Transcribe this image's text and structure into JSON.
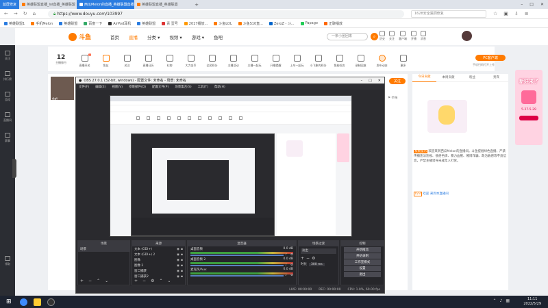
{
  "browser": {
    "tabs": [
      {
        "label": "英雄联盟直播_lol直播_英雄联盟",
        "active": false
      },
      {
        "label": "西瓜Melon的直播_英雄联盟直播",
        "active": true
      },
      {
        "label": "英雄联盟直播_英雄联盟",
        "active": false
      }
    ],
    "url": "https://www.douyu.com/103997",
    "search_hint": "1628安全漏洞修复",
    "sidebar_badge": "蓝屏修复",
    "bookmarks": [
      "英雄联盟1",
      "手机Melon",
      "英雄联盟",
      "百度一下",
      "AirPod耳机",
      "英雄联盟",
      "青 壹号",
      "2017播放...",
      "斗鱼LOL",
      "斗鱼S10直...",
      "ZeroZ - 斗...",
      "Papago",
      "正聊播放"
    ]
  },
  "site": {
    "logo": "斗鱼",
    "nav": [
      "首页",
      "直播",
      "分类",
      "视频",
      "游戏",
      "鱼吧"
    ],
    "search_placeholder": "一条小团团来",
    "header_icons": [
      "历史",
      "关注",
      "客户端",
      "开播",
      "消息"
    ],
    "left_nav": [
      "关注",
      "排行榜",
      "游戏",
      "直播间",
      "赛事",
      "领取"
    ],
    "rank": {
      "value": "12",
      "label": "主播排行"
    },
    "categories": [
      "直播开关",
      "鱼友",
      "关注",
      "直播日历",
      "礼物",
      "大力金币",
      "全民积分",
      "主播活动",
      "主播一起玩",
      "开播提醒",
      "上车一起玩",
      "小飞象的积分",
      "鱼翅任务",
      "录制回放",
      "发布动态",
      "更多"
    ],
    "category_badges": {
      "直播开关": "2"
    },
    "pc_button": "PC客户端",
    "pc_sub": "手机扫码打开上传",
    "streamer": "鱼吧",
    "report": "举报",
    "follow_button": "关注",
    "right_tabs": [
      "今日贡献",
      "本周贡献",
      "粉丝",
      "贵宾"
    ],
    "chat_notice_tag": "系统提示",
    "chat_notice": "欢迎来到西瓜Melon的直播间。斗鱼提倡绿色直播，严禁传播违法违规、低俗色情、暴力血腥、赌博诈骗、政治敏感等不良信息，严禁主播诱导未成年人打赏。",
    "chat_user_tag": "LV3",
    "chat_user": "欢迎 来到本直播间",
    "ad_title": "新娃来了",
    "ad_date": "5.27-5.29"
  },
  "obs": {
    "title": "OBS 27.0.1 (32-bit, windows) - 配置文件: 未命名 - 场景: 未命名",
    "menu": [
      "文件(F)",
      "编辑(E)",
      "视图(V)",
      "停靠部件(D)",
      "配置文件(P)",
      "场景集合(S)",
      "工具(T)",
      "帮助(H)"
    ],
    "docks": [
      "场景",
      "来源",
      "混音器",
      "场景过渡",
      "控制"
    ],
    "scene": "场景",
    "sources": [
      "文本 (GDI+)",
      "文本 (GDI+) 2",
      "图像",
      "图像 2",
      "窗口捕获",
      "窗口捕获2"
    ],
    "mixer": [
      {
        "name": "桌面音频",
        "db": "0.0 dB"
      },
      {
        "name": "桌面音频 2",
        "db": "0.0 dB"
      },
      {
        "name": "麦克风/Aux",
        "db": "0.0 dB"
      }
    ],
    "transition": "淡出",
    "duration_label": "时长",
    "duration": "300 ms",
    "controls": [
      "开始推流",
      "开始录制",
      "工作室模式",
      "设置",
      "退出"
    ],
    "status": [
      "LIVE: 00:00:00",
      "REC: 00:00:00",
      "CPU: 1.0%, 60.00 fps"
    ]
  },
  "taskbar": {
    "time": "11:11",
    "date": "2022/5/29"
  }
}
